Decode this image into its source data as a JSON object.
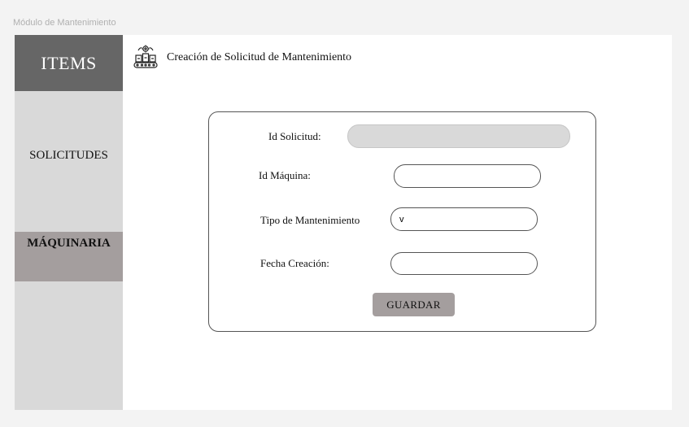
{
  "frame": {
    "label": "Módulo de Mantenimiento"
  },
  "sidebar": {
    "header": "ITEMS",
    "items": [
      {
        "label": "SOLICITUDES",
        "active": false
      },
      {
        "label": "MÁQUINARIA",
        "active": true
      }
    ]
  },
  "header": {
    "icon": "conveyor-gear-icon",
    "title": "Creación de Solicitud de Mantenimiento"
  },
  "form": {
    "fields": [
      {
        "label": "Id Solicitud:",
        "value": "",
        "readonly": true
      },
      {
        "label": "Id Máquina:",
        "value": ""
      },
      {
        "label": "Tipo de Mantenimiento",
        "value": "v",
        "type": "select"
      },
      {
        "label": "Fecha Creación:",
        "value": ""
      }
    ],
    "save_label": "GUARDAR"
  },
  "colors": {
    "sidebar_bg": "#d9d9d9",
    "sidebar_header_bg": "#666666",
    "active_item_bg": "#a49e9e",
    "button_bg": "#a49e9e"
  }
}
